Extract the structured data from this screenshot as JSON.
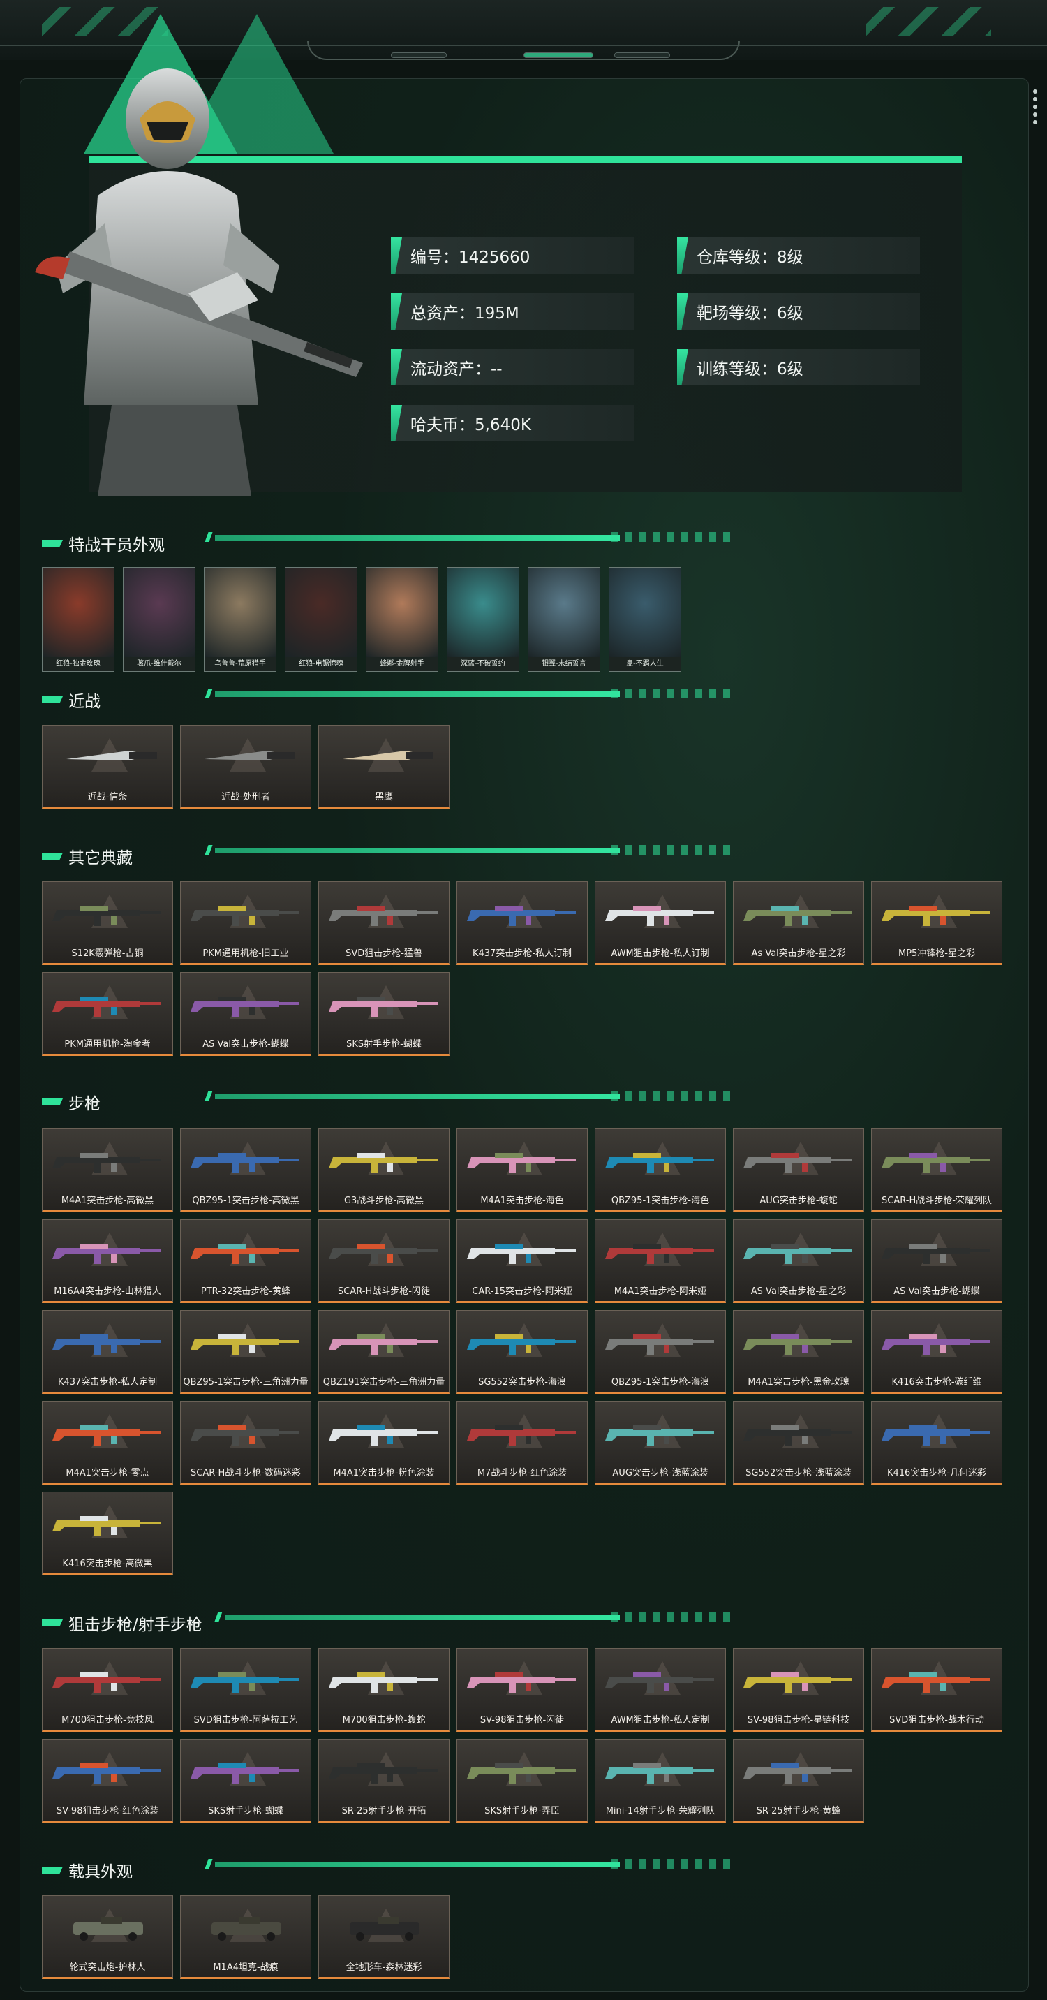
{
  "profile": {
    "fields": [
      {
        "text": "编号：1425660"
      },
      {
        "text": "仓库等级：8级"
      },
      {
        "text": "总资产：195M"
      },
      {
        "text": "靶场等级：6级"
      },
      {
        "text": "流动资产：--"
      },
      {
        "text": "训练等级：6级"
      },
      {
        "text": "哈夫币：5,640K"
      }
    ]
  },
  "sections": {
    "operators": {
      "title": "特战干员外观",
      "items": [
        "红狼-独金玫瑰",
        "骇爪-维什戴尔",
        "乌鲁鲁-荒原猎手",
        "红狼-电锯惊魂",
        "蜂娜-金牌射手",
        "深蓝-不破誓约",
        "银翼-末结誓言",
        "蛊-不羁人生"
      ]
    },
    "melee": {
      "title": "近战",
      "items": [
        "近战-信条",
        "近战-处刑者",
        "黑鹰"
      ]
    },
    "collection": {
      "title": "其它典藏",
      "items": [
        "S12K霰弹枪-古铜",
        "PKM通用机枪-旧工业",
        "SVD狙击步枪-猛兽",
        "K437突击步枪-私人订制",
        "AWM狙击步枪-私人订制",
        "As Val突击步枪-星之彩",
        "MP5冲锋枪-星之彩",
        "PKM通用机枪-淘金者",
        "AS Val突击步枪-蝴蝶",
        "SKS射手步枪-蝴蝶"
      ]
    },
    "rifles": {
      "title": "步枪",
      "items": [
        "M4A1突击步枪-高微黑",
        "QBZ95-1突击步枪-高微黑",
        "G3战斗步枪-高微黑",
        "M4A1突击步枪-海色",
        "QBZ95-1突击步枪-海色",
        "AUG突击步枪-蝮蛇",
        "SCAR-H战斗步枪-荣耀列队",
        "M16A4突击步枪-山林猎人",
        "PTR-32突击步枪-黄蜂",
        "SCAR-H战斗步枪-闪徒",
        "CAR-15突击步枪-阿米娅",
        "M4A1突击步枪-阿米娅",
        "AS Val突击步枪-星之彩",
        "AS Val突击步枪-蝴蝶",
        "K437突击步枪-私人定制",
        "QBZ95-1突击步枪-三角洲力量",
        "QBZ191突击步枪-三角洲力量",
        "SG552突击步枪-海浪",
        "QBZ95-1突击步枪-海浪",
        "M4A1突击步枪-黑金玫瑰",
        "K416突击步枪-碳纤维",
        "M4A1突击步枪-零点",
        "SCAR-H战斗步枪-数码迷彩",
        "M4A1突击步枪-粉色涂装",
        "M7战斗步枪-红色涂装",
        "AUG突击步枪-浅蓝涂装",
        "SG552突击步枪-浅蓝涂装",
        "K416突击步枪-几何迷彩",
        "K416突击步枪-高微黑"
      ]
    },
    "snipers": {
      "title": "狙击步枪/射手步枪",
      "items": [
        "M700狙击步枪-竞技风",
        "SVD狙击步枪-阿萨拉工艺",
        "M700狙击步枪-蝮蛇",
        "SV-98狙击步枪-闪徒",
        "AWM狙击步枪-私人定制",
        "SV-98狙击步枪-星链科技",
        "SVD狙击步枪-战术行动",
        "SV-98狙击步枪-红色涂装",
        "SKS射手步枪-蝴蝶",
        "SR-25射手步枪-开拓",
        "SKS射手步枪-弄臣",
        "Mini-14射手步枪-荣耀列队",
        "SR-25射手步枪-黄蜂"
      ]
    },
    "vehicles": {
      "title": "载具外观",
      "items": [
        "轮式突击炮-护林人",
        "M1A4坦克-战痕",
        "全地形车-森林迷彩"
      ]
    }
  },
  "colors": {
    "accent": "#2fe39a",
    "card_bottom": "#e68a3c"
  }
}
